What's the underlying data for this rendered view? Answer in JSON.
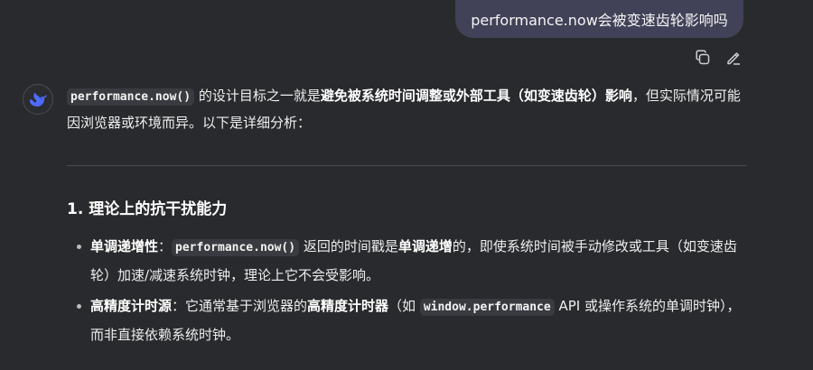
{
  "user_message": {
    "text": "performance.now会被变速齿轮影响吗"
  },
  "actions": {
    "copy_icon": "copy-icon",
    "edit_icon": "edit-icon"
  },
  "assistant": {
    "avatar_icon": "whale-logo-icon",
    "intro": {
      "code": "performance.now()",
      "t1": " 的设计目标之一就是",
      "bold1": "避免被系统时间调整或外部工具（如变速齿轮）影响",
      "t2": "，但实际情况可能因浏览器或环境而异。以下是详细分析："
    },
    "section1": {
      "title": "1. 理论上的抗干扰能力",
      "bullets": [
        {
          "bold": "单调递增性",
          "colon": "：",
          "code": "performance.now()",
          "t1": " 返回的时间戳是",
          "bold2": "单调递增",
          "t2": "的，即使系统时间被手动修改或工具（如变速齿轮）加速/减速系统时钟，理论上它不会受影响。"
        },
        {
          "bold": "高精度计时源",
          "t1": "：它通常基于浏览器的",
          "bold2": "高精度计时器",
          "t2": "（如 ",
          "code": "window.performance",
          "t3": " API 或操作系统的单调时钟），而非直接依赖系统时钟。"
        }
      ]
    }
  },
  "colors": {
    "background": "#292a2d",
    "user_bubble": "#414158",
    "code_bg": "#3a3b40",
    "logo_blue": "#4d6bfe"
  }
}
